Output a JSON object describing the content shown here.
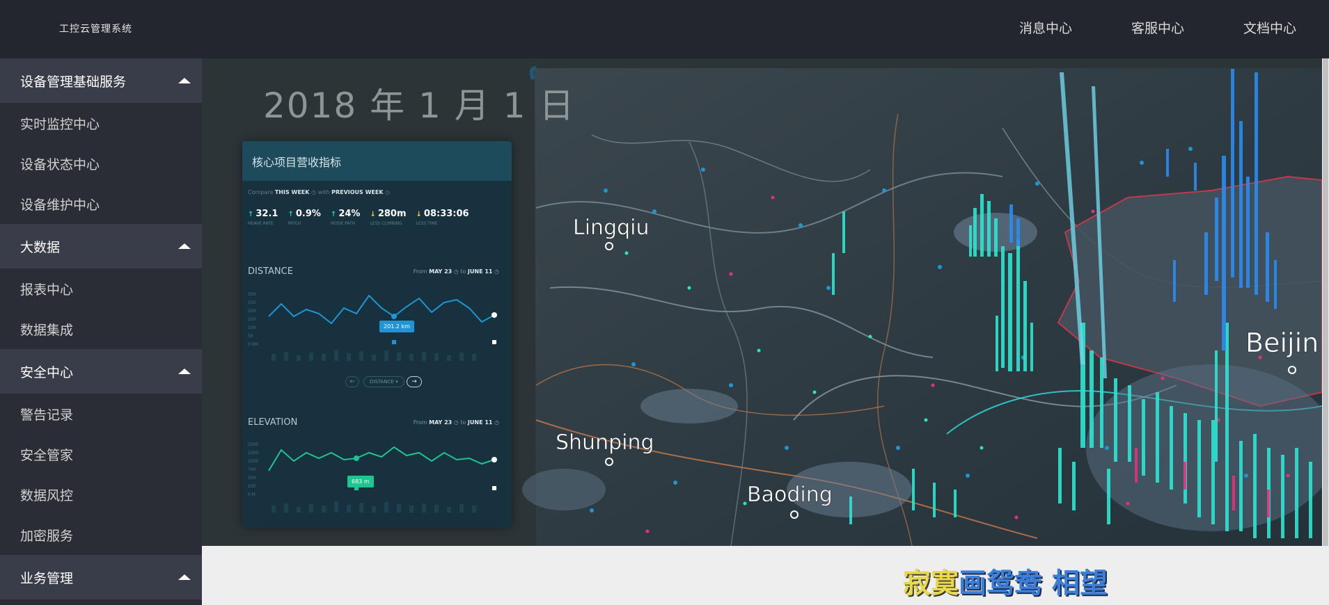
{
  "app": {
    "title": "工控云管理系统"
  },
  "topnav": [
    "消息中心",
    "客服中心",
    "文档中心"
  ],
  "sidebar": [
    {
      "title": "设备管理基础服务",
      "items": [
        "实时监控中心",
        "设备状态中心",
        "设备维护中心"
      ]
    },
    {
      "title": "大数据",
      "items": [
        "报表中心",
        "数据集成"
      ]
    },
    {
      "title": "安全中心",
      "items": [
        "警告记录",
        "安全管家",
        "数据风控",
        "加密服务"
      ]
    },
    {
      "title": "业务管理",
      "items": []
    }
  ],
  "banner": {
    "date": "2018 年 1 月 1 日",
    "card": {
      "title": "核心项目营收指标",
      "compare_prefix": "Compare",
      "compare_a": "THIS WEEK",
      "compare_mid": "with",
      "compare_b": "PREVIOUS WEEK",
      "stats": [
        {
          "value": "32.1",
          "caption": "HEAVE RATE"
        },
        {
          "value": "0.9%",
          "caption": "PATCH"
        },
        {
          "value": "24%",
          "caption": "MODE PATH"
        },
        {
          "value": "280m",
          "caption": "LESS CLIMBING"
        },
        {
          "value": "08:33:06",
          "caption": "LESS TIME"
        }
      ],
      "distance": {
        "title": "DISTANCE",
        "from_label": "From",
        "from": "MAY 23",
        "to_label": "to",
        "to": "JUNE 11",
        "tooltip": "201.2 km",
        "select_label": "DISTANCE",
        "y_ticks": [
          "300",
          "250",
          "200",
          "150",
          "100",
          "50",
          "0 KM"
        ]
      },
      "elevation": {
        "title": "ELEVATION",
        "from_label": "From",
        "from": "MAY 23",
        "to_label": "to",
        "to": "JUNE 11",
        "tooltip": "683 m",
        "y_ticks": [
          "2000",
          "1500",
          "1000",
          "700",
          "500",
          "250",
          "0 M"
        ]
      }
    },
    "map_labels": [
      "Lingqiu",
      "Shunping",
      "Baoding",
      "Beijin"
    ]
  },
  "footer": {
    "text_a": "寂寞",
    "text_b": "画鸳鸯",
    "text_c": " 相望"
  },
  "colors": {
    "topbar": "#23262e",
    "sidebar": "#2a2d36",
    "group_head": "#393d49",
    "accent_teal": "#29d3b0",
    "accent_blue": "#1e96d6"
  }
}
